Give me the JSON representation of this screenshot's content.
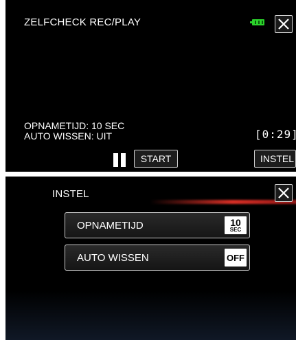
{
  "screen1": {
    "title": "ZELFCHECK REC/PLAY",
    "icons": {
      "battery": "battery-full-icon",
      "close": "close-icon",
      "pause": "pause-icon"
    },
    "recording_time_info": "OPNAMETIJD: 10 SEC",
    "auto_delete_info": "AUTO WISSEN: UIT",
    "timer": "[0:29]",
    "start_label": "START",
    "settings_label": "INSTEL"
  },
  "screen2": {
    "title": "INSTEL",
    "icons": {
      "close": "close-icon"
    },
    "menu": [
      {
        "label": "OPNAMETIJD",
        "value_num": "10",
        "value_unit": "SEC"
      },
      {
        "label": "AUTO WISSEN",
        "value": "OFF"
      }
    ]
  },
  "colors": {
    "background": "#000000",
    "battery": "#2bd32b",
    "accent_line": "#e63228"
  }
}
